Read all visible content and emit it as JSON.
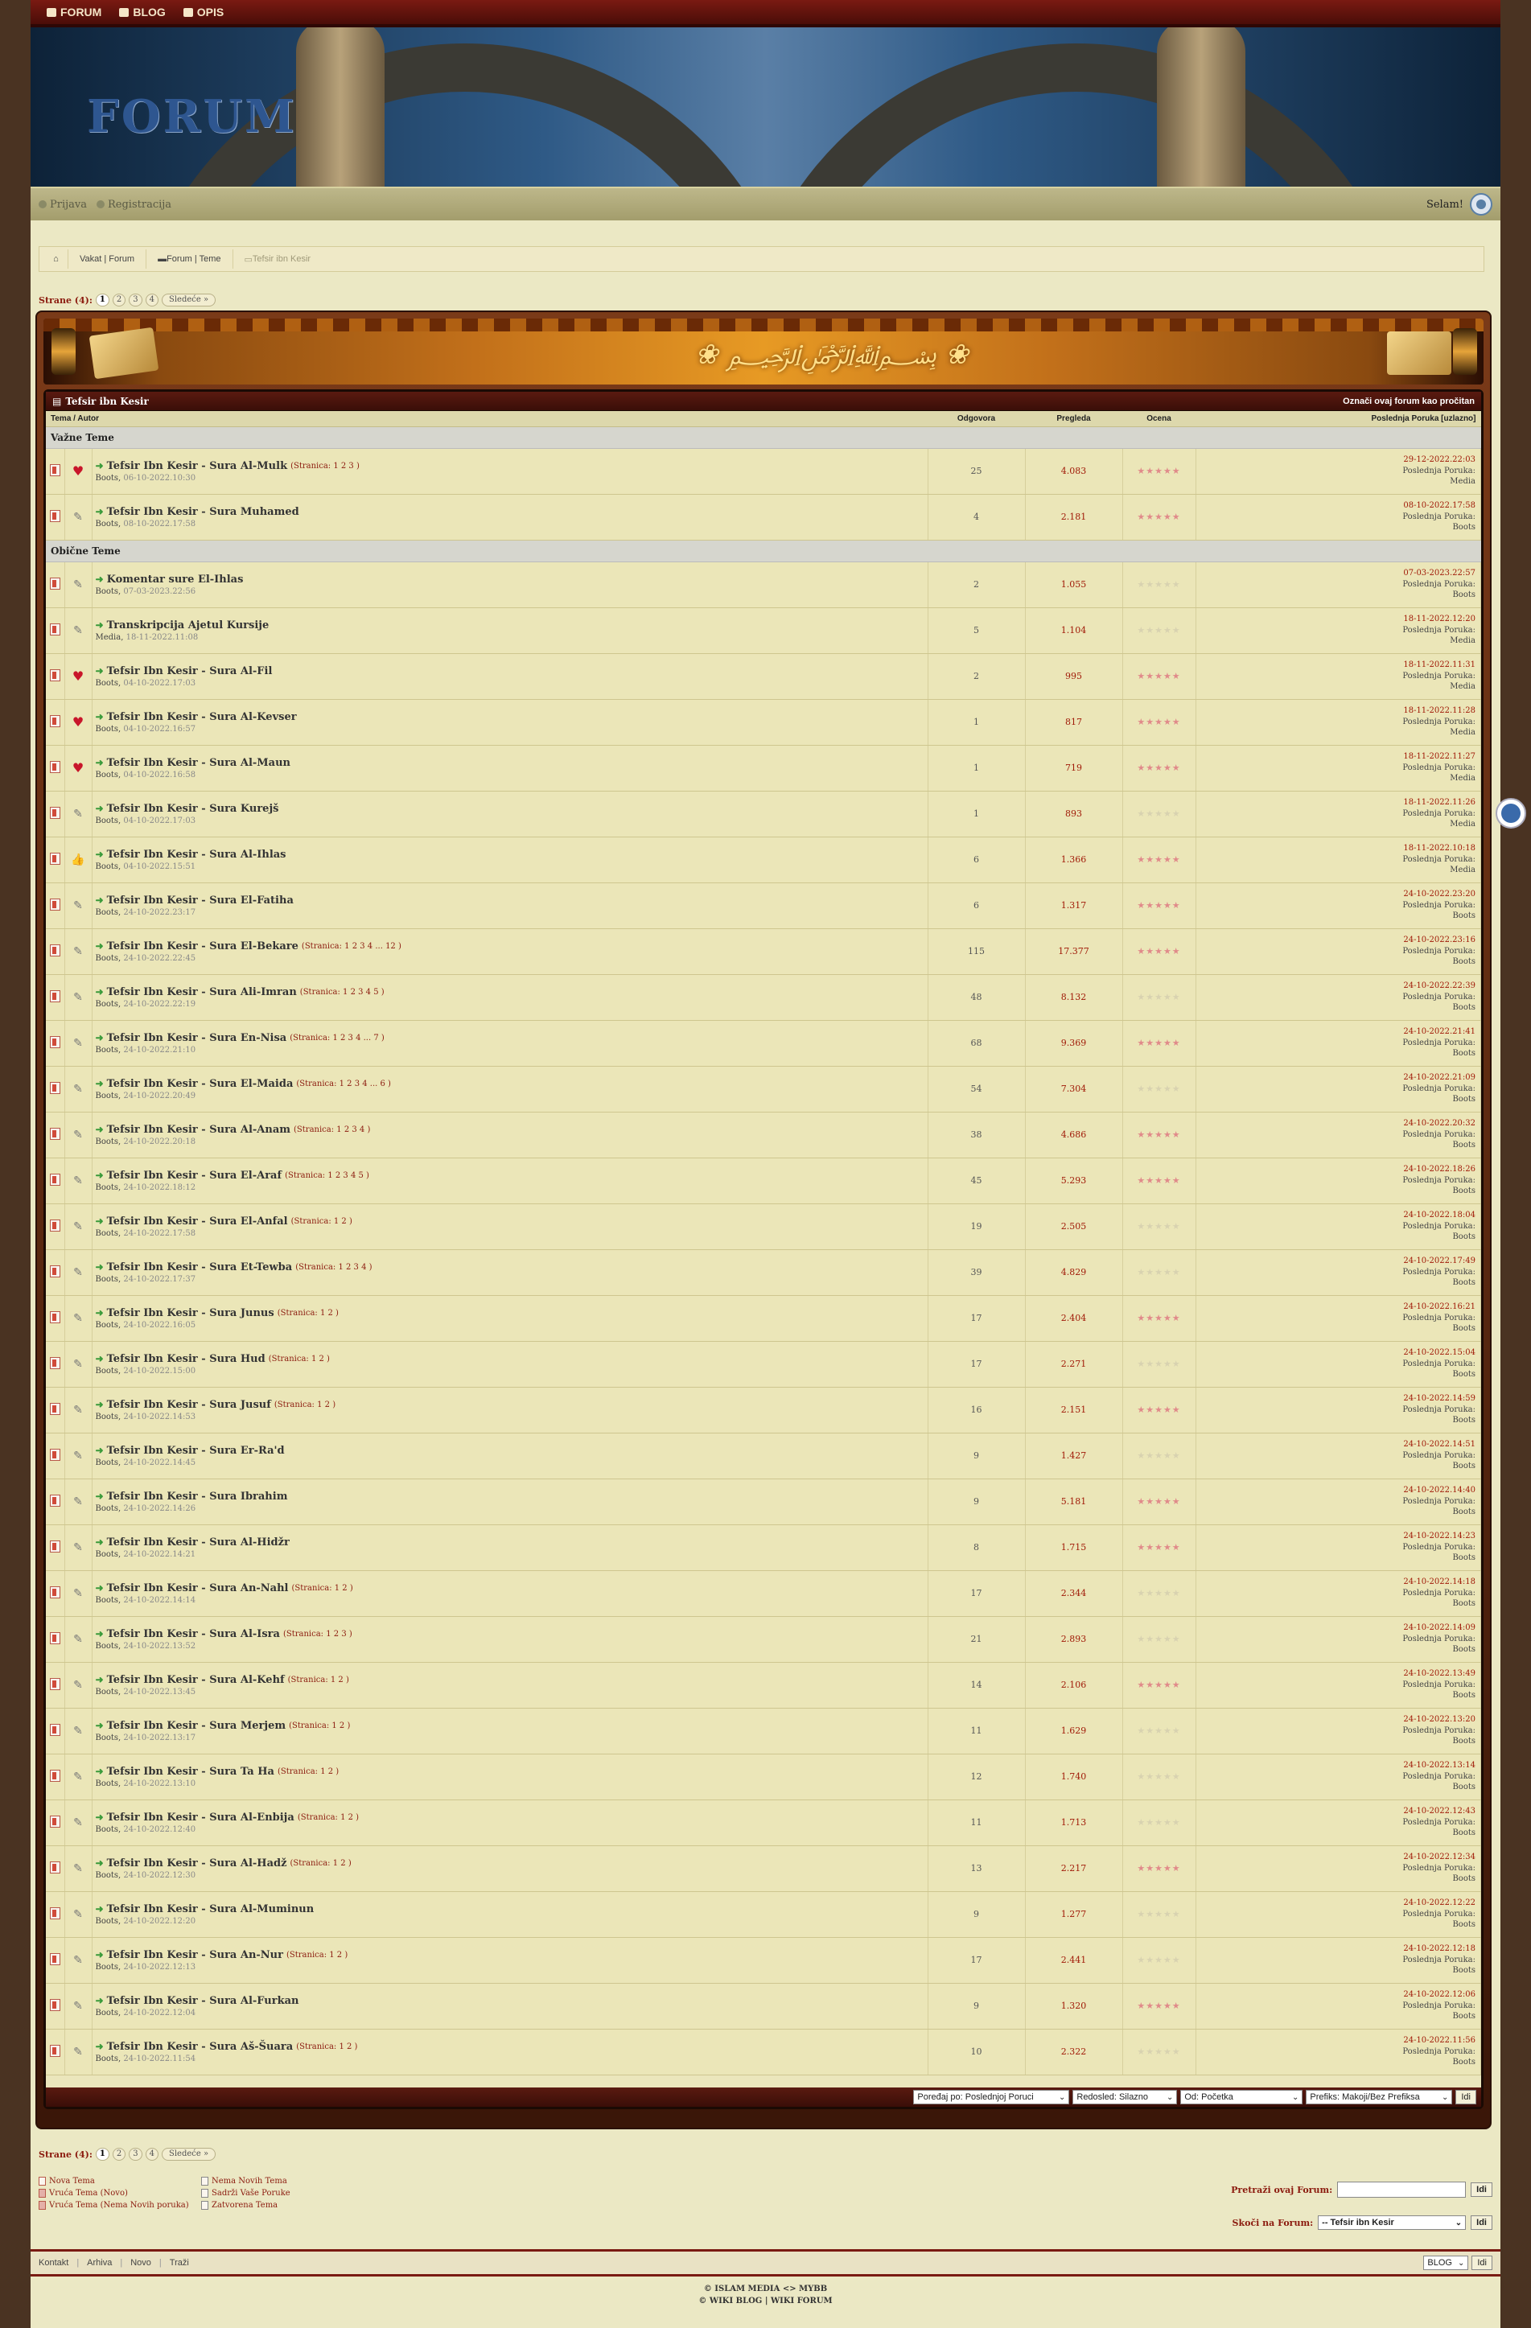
{
  "topnav": [
    {
      "label": "FORUM",
      "icon": "home-icon"
    },
    {
      "label": "BLOG",
      "icon": "diamond-icon"
    },
    {
      "label": "OPIS",
      "icon": "info-icon"
    }
  ],
  "header": {
    "logo": "FORUM"
  },
  "userbar": {
    "login": "Prijava",
    "register": "Registracija",
    "greeting": "Selam!"
  },
  "breadcrumb": {
    "items": [
      "Vakat | Forum",
      "Forum | Teme",
      "Tefsir ibn Kesir"
    ]
  },
  "pager": {
    "label": "Strane (4):",
    "pages": [
      "1",
      "2",
      "3",
      "4"
    ],
    "next": "Sledeće »"
  },
  "forum": {
    "title": "Tefsir ibn Kesir",
    "mark_read": "Označi ovaj forum kao pročitan"
  },
  "columns": {
    "topic": "Tema / Autor",
    "replies": "Odgovora",
    "views": "Pregleda",
    "rating": "Ocena",
    "last": "Poslednja Poruka [uzlazno]"
  },
  "sections": {
    "sticky": "Važne Teme",
    "normal": "Obične Teme"
  },
  "last_label": "Poslednja Poruka:",
  "sticky_threads": [
    {
      "title": "Tefsir Ibn Kesir - Sura Al-Mulk",
      "pages": "(Stranica: 1 2 3 )",
      "author": "Boots",
      "date": "06-10-2022.10:30",
      "replies": "25",
      "views": "4.083",
      "rated": true,
      "last_date": "29-12-2022.22:03",
      "last_author": "Media",
      "mood": "heart"
    },
    {
      "title": "Tefsir Ibn Kesir - Sura Muhamed",
      "pages": "",
      "author": "Boots",
      "date": "08-10-2022.17:58",
      "replies": "4",
      "views": "2.181",
      "rated": true,
      "last_date": "08-10-2022.17:58",
      "last_author": "Boots",
      "mood": "pencil"
    }
  ],
  "threads": [
    {
      "title": "Komentar sure El-Ihlas",
      "pages": "",
      "author": "Boots",
      "date": "07-03-2023.22:56",
      "replies": "2",
      "views": "1.055",
      "rated": false,
      "last_date": "07-03-2023.22:57",
      "last_author": "Boots",
      "mood": "pencil"
    },
    {
      "title": "Transkripcija Ajetul Kursije",
      "pages": "",
      "author": "Media",
      "date": "18-11-2022.11:08",
      "replies": "5",
      "views": "1.104",
      "rated": false,
      "last_date": "18-11-2022.12:20",
      "last_author": "Media",
      "mood": "pencil"
    },
    {
      "title": "Tefsir Ibn Kesir - Sura Al-Fil",
      "pages": "",
      "author": "Boots",
      "date": "04-10-2022.17:03",
      "replies": "2",
      "views": "995",
      "rated": true,
      "last_date": "18-11-2022.11:31",
      "last_author": "Media",
      "mood": "heart"
    },
    {
      "title": "Tefsir Ibn Kesir - Sura Al-Kevser",
      "pages": "",
      "author": "Boots",
      "date": "04-10-2022.16:57",
      "replies": "1",
      "views": "817",
      "rated": true,
      "last_date": "18-11-2022.11:28",
      "last_author": "Media",
      "mood": "heart"
    },
    {
      "title": "Tefsir Ibn Kesir - Sura Al-Maun",
      "pages": "",
      "author": "Boots",
      "date": "04-10-2022.16:58",
      "replies": "1",
      "views": "719",
      "rated": true,
      "last_date": "18-11-2022.11:27",
      "last_author": "Media",
      "mood": "heart"
    },
    {
      "title": "Tefsir Ibn Kesir - Sura Kurejš",
      "pages": "",
      "author": "Boots",
      "date": "04-10-2022.17:03",
      "replies": "1",
      "views": "893",
      "rated": false,
      "last_date": "18-11-2022.11:26",
      "last_author": "Media",
      "mood": "pencil"
    },
    {
      "title": "Tefsir Ibn Kesir - Sura Al-Ihlas",
      "pages": "",
      "author": "Boots",
      "date": "04-10-2022.15:51",
      "replies": "6",
      "views": "1.366",
      "rated": true,
      "last_date": "18-11-2022.10:18",
      "last_author": "Media",
      "mood": "thumb"
    },
    {
      "title": "Tefsir Ibn Kesir - Sura El-Fatiha",
      "pages": "",
      "author": "Boots",
      "date": "24-10-2022.23:17",
      "replies": "6",
      "views": "1.317",
      "rated": true,
      "last_date": "24-10-2022.23:20",
      "last_author": "Boots",
      "mood": "pencil"
    },
    {
      "title": "Tefsir Ibn Kesir - Sura El-Bekare",
      "pages": "(Stranica: 1 2 3 4 ... 12 )",
      "author": "Boots",
      "date": "24-10-2022.22:45",
      "replies": "115",
      "views": "17.377",
      "rated": true,
      "last_date": "24-10-2022.23:16",
      "last_author": "Boots",
      "mood": "pencil"
    },
    {
      "title": "Tefsir Ibn Kesir - Sura Ali-Imran",
      "pages": "(Stranica: 1 2 3 4 5 )",
      "author": "Boots",
      "date": "24-10-2022.22:19",
      "replies": "48",
      "views": "8.132",
      "rated": false,
      "last_date": "24-10-2022.22:39",
      "last_author": "Boots",
      "mood": "pencil"
    },
    {
      "title": "Tefsir Ibn Kesir - Sura En-Nisa",
      "pages": "(Stranica: 1 2 3 4 ... 7 )",
      "author": "Boots",
      "date": "24-10-2022.21:10",
      "replies": "68",
      "views": "9.369",
      "rated": true,
      "last_date": "24-10-2022.21:41",
      "last_author": "Boots",
      "mood": "pencil"
    },
    {
      "title": "Tefsir Ibn Kesir - Sura El-Maida",
      "pages": "(Stranica: 1 2 3 4 ... 6 )",
      "author": "Boots",
      "date": "24-10-2022.20:49",
      "replies": "54",
      "views": "7.304",
      "rated": false,
      "last_date": "24-10-2022.21:09",
      "last_author": "Boots",
      "mood": "pencil"
    },
    {
      "title": "Tefsir Ibn Kesir - Sura Al-Anam",
      "pages": "(Stranica: 1 2 3 4 )",
      "author": "Boots",
      "date": "24-10-2022.20:18",
      "replies": "38",
      "views": "4.686",
      "rated": true,
      "last_date": "24-10-2022.20:32",
      "last_author": "Boots",
      "mood": "pencil"
    },
    {
      "title": "Tefsir Ibn Kesir - Sura El-Araf",
      "pages": "(Stranica: 1 2 3 4 5 )",
      "author": "Boots",
      "date": "24-10-2022.18:12",
      "replies": "45",
      "views": "5.293",
      "rated": true,
      "last_date": "24-10-2022.18:26",
      "last_author": "Boots",
      "mood": "pencil"
    },
    {
      "title": "Tefsir Ibn Kesir - Sura El-Anfal",
      "pages": "(Stranica: 1 2 )",
      "author": "Boots",
      "date": "24-10-2022.17:58",
      "replies": "19",
      "views": "2.505",
      "rated": false,
      "last_date": "24-10-2022.18:04",
      "last_author": "Boots",
      "mood": "pencil"
    },
    {
      "title": "Tefsir Ibn Kesir - Sura Et-Tewba",
      "pages": "(Stranica: 1 2 3 4 )",
      "author": "Boots",
      "date": "24-10-2022.17:37",
      "replies": "39",
      "views": "4.829",
      "rated": false,
      "last_date": "24-10-2022.17:49",
      "last_author": "Boots",
      "mood": "pencil"
    },
    {
      "title": "Tefsir Ibn Kesir - Sura Junus",
      "pages": "(Stranica: 1 2 )",
      "author": "Boots",
      "date": "24-10-2022.16:05",
      "replies": "17",
      "views": "2.404",
      "rated": true,
      "last_date": "24-10-2022.16:21",
      "last_author": "Boots",
      "mood": "pencil"
    },
    {
      "title": "Tefsir Ibn Kesir - Sura Hud",
      "pages": "(Stranica: 1 2 )",
      "author": "Boots",
      "date": "24-10-2022.15:00",
      "replies": "17",
      "views": "2.271",
      "rated": false,
      "last_date": "24-10-2022.15:04",
      "last_author": "Boots",
      "mood": "pencil"
    },
    {
      "title": "Tefsir Ibn Kesir - Sura Jusuf",
      "pages": "(Stranica: 1 2 )",
      "author": "Boots",
      "date": "24-10-2022.14:53",
      "replies": "16",
      "views": "2.151",
      "rated": true,
      "last_date": "24-10-2022.14:59",
      "last_author": "Boots",
      "mood": "pencil"
    },
    {
      "title": "Tefsir Ibn Kesir - Sura Er-Ra'd",
      "pages": "",
      "author": "Boots",
      "date": "24-10-2022.14:45",
      "replies": "9",
      "views": "1.427",
      "rated": false,
      "last_date": "24-10-2022.14:51",
      "last_author": "Boots",
      "mood": "pencil"
    },
    {
      "title": "Tefsir Ibn Kesir - Sura Ibrahim",
      "pages": "",
      "author": "Boots",
      "date": "24-10-2022.14:26",
      "replies": "9",
      "views": "5.181",
      "rated": true,
      "last_date": "24-10-2022.14:40",
      "last_author": "Boots",
      "mood": "pencil"
    },
    {
      "title": "Tefsir Ibn Kesir - Sura Al-Hidžr",
      "pages": "",
      "author": "Boots",
      "date": "24-10-2022.14:21",
      "replies": "8",
      "views": "1.715",
      "rated": true,
      "last_date": "24-10-2022.14:23",
      "last_author": "Boots",
      "mood": "pencil"
    },
    {
      "title": "Tefsir Ibn Kesir - Sura An-Nahl",
      "pages": "(Stranica: 1 2 )",
      "author": "Boots",
      "date": "24-10-2022.14:14",
      "replies": "17",
      "views": "2.344",
      "rated": false,
      "last_date": "24-10-2022.14:18",
      "last_author": "Boots",
      "mood": "pencil"
    },
    {
      "title": "Tefsir Ibn Kesir - Sura Al-Isra",
      "pages": "(Stranica: 1 2 3 )",
      "author": "Boots",
      "date": "24-10-2022.13:52",
      "replies": "21",
      "views": "2.893",
      "rated": false,
      "last_date": "24-10-2022.14:09",
      "last_author": "Boots",
      "mood": "pencil"
    },
    {
      "title": "Tefsir Ibn Kesir - Sura Al-Kehf",
      "pages": "(Stranica: 1 2 )",
      "author": "Boots",
      "date": "24-10-2022.13:45",
      "replies": "14",
      "views": "2.106",
      "rated": true,
      "last_date": "24-10-2022.13:49",
      "last_author": "Boots",
      "mood": "pencil"
    },
    {
      "title": "Tefsir Ibn Kesir - Sura Merjem",
      "pages": "(Stranica: 1 2 )",
      "author": "Boots",
      "date": "24-10-2022.13:17",
      "replies": "11",
      "views": "1.629",
      "rated": false,
      "last_date": "24-10-2022.13:20",
      "last_author": "Boots",
      "mood": "pencil"
    },
    {
      "title": "Tefsir Ibn Kesir - Sura Ta Ha",
      "pages": "(Stranica: 1 2 )",
      "author": "Boots",
      "date": "24-10-2022.13:10",
      "replies": "12",
      "views": "1.740",
      "rated": false,
      "last_date": "24-10-2022.13:14",
      "last_author": "Boots",
      "mood": "pencil"
    },
    {
      "title": "Tefsir Ibn Kesir - Sura Al-Enbija",
      "pages": "(Stranica: 1 2 )",
      "author": "Boots",
      "date": "24-10-2022.12:40",
      "replies": "11",
      "views": "1.713",
      "rated": false,
      "last_date": "24-10-2022.12:43",
      "last_author": "Boots",
      "mood": "pencil"
    },
    {
      "title": "Tefsir Ibn Kesir - Sura Al-Hadž",
      "pages": "(Stranica: 1 2 )",
      "author": "Boots",
      "date": "24-10-2022.12:30",
      "replies": "13",
      "views": "2.217",
      "rated": true,
      "last_date": "24-10-2022.12:34",
      "last_author": "Boots",
      "mood": "pencil"
    },
    {
      "title": "Tefsir Ibn Kesir - Sura Al-Muminun",
      "pages": "",
      "author": "Boots",
      "date": "24-10-2022.12:20",
      "replies": "9",
      "views": "1.277",
      "rated": false,
      "last_date": "24-10-2022.12:22",
      "last_author": "Boots",
      "mood": "pencil"
    },
    {
      "title": "Tefsir Ibn Kesir - Sura An-Nur",
      "pages": "(Stranica: 1 2 )",
      "author": "Boots",
      "date": "24-10-2022.12:13",
      "replies": "17",
      "views": "2.441",
      "rated": false,
      "last_date": "24-10-2022.12:18",
      "last_author": "Boots",
      "mood": "pencil"
    },
    {
      "title": "Tefsir Ibn Kesir - Sura Al-Furkan",
      "pages": "",
      "author": "Boots",
      "date": "24-10-2022.12:04",
      "replies": "9",
      "views": "1.320",
      "rated": true,
      "last_date": "24-10-2022.12:06",
      "last_author": "Boots",
      "mood": "pencil"
    },
    {
      "title": "Tefsir Ibn Kesir - Sura Aš-Šuara",
      "pages": "(Stranica: 1 2 )",
      "author": "Boots",
      "date": "24-10-2022.11:54",
      "replies": "10",
      "views": "2.322",
      "rated": false,
      "last_date": "24-10-2022.11:56",
      "last_author": "Boots",
      "mood": "pencil"
    }
  ],
  "sortbar": {
    "sort": "Poređaj po: Poslednjoj Poruci",
    "order": "Redosled: Silazno",
    "from": "Od: Početka",
    "prefix": "Prefiks: Makoji/Bez Prefiksa",
    "go": "Idi"
  },
  "legend": {
    "new": "Nova Tema",
    "no_new": "Nema Novih Tema",
    "hot_new": "Vruća Tema (Novo)",
    "contains": "Sadrži Vaše Poruke",
    "hot_no_new": "Vruća Tema (Nema Novih poruka)",
    "closed": "Zatvorena Tema"
  },
  "tools": {
    "search_label": "Pretraži ovaj Forum:",
    "go": "Idi",
    "jump_label": "Skoči na Forum:",
    "jump_value": "-- Tefsir ibn Kesir"
  },
  "footer": {
    "links": [
      "Kontakt",
      "Arhiva",
      "Novo",
      "Traži"
    ],
    "theme": "BLOG",
    "go": "Idi"
  },
  "copyright": {
    "line1": "© ISLAM MEDIA <> MYBB",
    "line2": "© WIKI BLOG | WIKI FORUM"
  }
}
